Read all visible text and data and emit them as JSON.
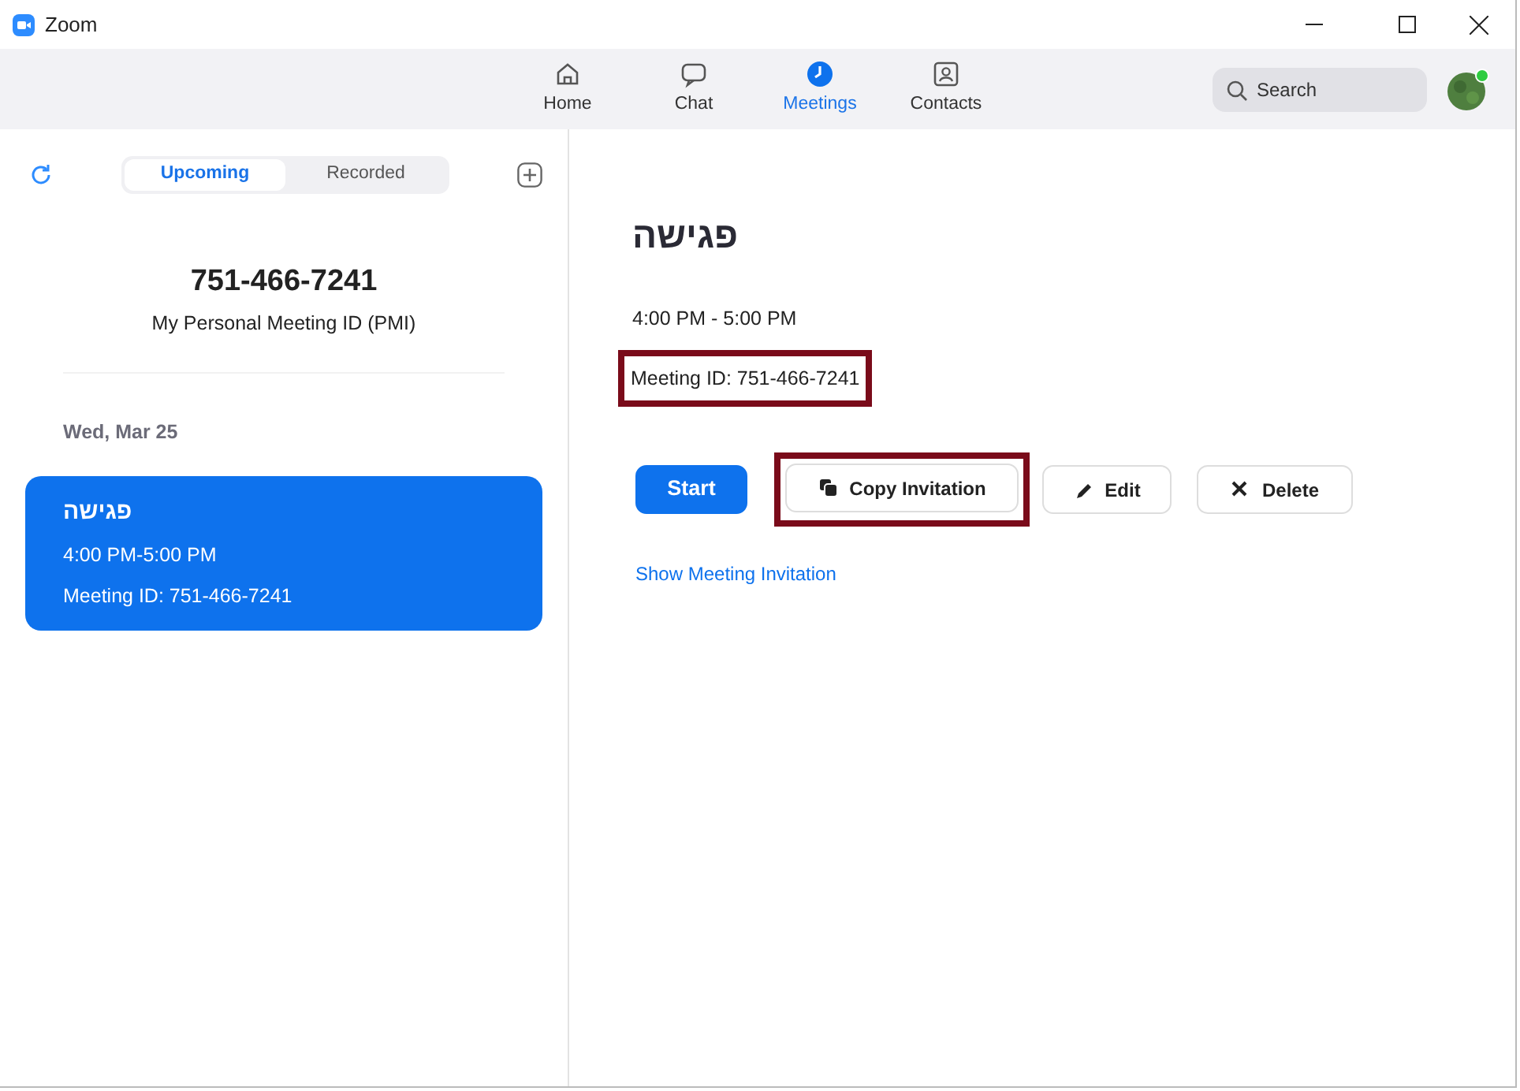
{
  "window": {
    "title": "Zoom"
  },
  "nav": {
    "tabs": [
      {
        "label": "Home",
        "kind": "home",
        "selected": false
      },
      {
        "label": "Chat",
        "kind": "chat",
        "selected": false
      },
      {
        "label": "Meetings",
        "kind": "clock",
        "selected": true
      },
      {
        "label": "Contacts",
        "kind": "contacts",
        "selected": false
      }
    ],
    "search": {
      "placeholder": "Search"
    },
    "avatar": {
      "online": true
    }
  },
  "sidebar": {
    "tabs": [
      {
        "label": "Upcoming",
        "selected": true
      },
      {
        "label": "Recorded",
        "selected": false
      }
    ],
    "pmi": {
      "number": "751-466-7241",
      "label": "My Personal Meeting ID (PMI)"
    },
    "date": "Wed, Mar 25",
    "meetings": [
      {
        "title": "פגישה",
        "time": "4:00 PM-5:00 PM",
        "meeting_id": "Meeting ID: 751-466-7241",
        "selected": true
      }
    ]
  },
  "detail": {
    "title": "פגישה",
    "time": "4:00 PM - 5:00 PM",
    "meeting_id": {
      "text": "Meeting ID: 751-466-7241",
      "highlighted": true
    },
    "buttons": [
      {
        "label": "Start",
        "kind": "primary",
        "highlighted": false
      },
      {
        "label": "Copy Invitation",
        "kind": "copy",
        "highlighted": true
      },
      {
        "label": "Edit",
        "kind": "edit",
        "highlighted": false
      },
      {
        "label": "Delete",
        "kind": "delete",
        "highlighted": false
      }
    ],
    "link": "Show Meeting Invitation"
  }
}
